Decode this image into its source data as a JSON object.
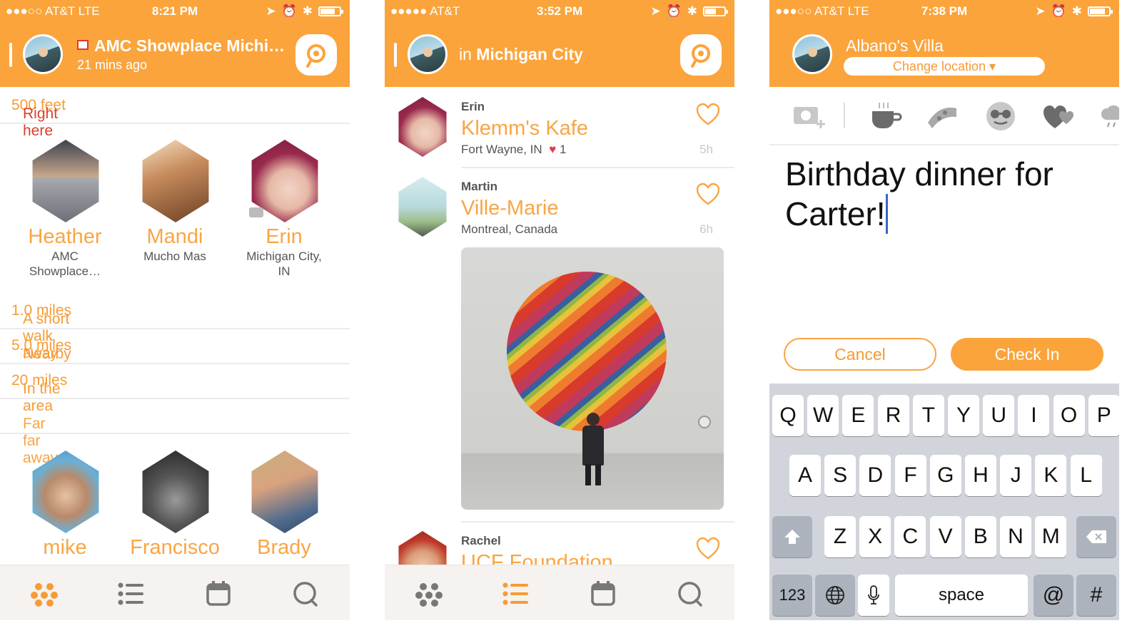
{
  "screen1": {
    "status": {
      "carrier": "●●●○○ AT&T  LTE",
      "time": "8:21 PM"
    },
    "header": {
      "title": "AMC Showplace Michi…",
      "subtitle": "21 mins ago"
    },
    "sections": [
      {
        "label": "Right here",
        "distance": "500 feet"
      },
      {
        "label": "A short walk away",
        "distance": "1.0 miles"
      },
      {
        "label": "Nearby",
        "distance": "5.0 miles"
      },
      {
        "label": "In the area",
        "distance": "20 miles"
      },
      {
        "label": "Far far away",
        "distance": ""
      }
    ],
    "friends": [
      {
        "name": "Heather",
        "loc1": "AMC",
        "loc2": "Showplace…"
      },
      {
        "name": "Mandi",
        "loc1": "Mucho Mas",
        "loc2": ""
      },
      {
        "name": "Erin",
        "loc1": "Michigan City,",
        "loc2": "IN"
      },
      {
        "name": "mike",
        "loc1": "",
        "loc2": ""
      },
      {
        "name": "Francisco",
        "loc1": "",
        "loc2": ""
      },
      {
        "name": "Brady",
        "loc1": "",
        "loc2": ""
      }
    ]
  },
  "screen2": {
    "status": {
      "carrier": "●●●●● AT&T",
      "time": "3:52 PM"
    },
    "header": {
      "prefix": "in",
      "city": "Michigan City"
    },
    "feed": [
      {
        "user": "Erin",
        "venue": "Klemm's Kafe",
        "location": "Fort Wayne, IN",
        "likes": "1",
        "time": "5h"
      },
      {
        "user": "Martin",
        "venue": "Ville-Marie",
        "location": "Montreal, Canada",
        "likes": "",
        "time": "6h"
      },
      {
        "user": "Rachel",
        "venue": "UCF Foundation",
        "location": "",
        "likes": "",
        "time": ""
      }
    ]
  },
  "screen3": {
    "status": {
      "carrier": "●●●○○ AT&T  LTE",
      "time": "7:38 PM"
    },
    "header": {
      "venue": "Albano's Villa",
      "change_location": "Change location ▾"
    },
    "message": {
      "line1": "Birthday dinner for",
      "line2": "Carter!"
    },
    "buttons": {
      "cancel": "Cancel",
      "checkin": "Check In"
    },
    "keyboard": {
      "row1": [
        "Q",
        "W",
        "E",
        "R",
        "T",
        "Y",
        "U",
        "I",
        "O",
        "P"
      ],
      "row2": [
        "A",
        "S",
        "D",
        "F",
        "G",
        "H",
        "J",
        "K",
        "L"
      ],
      "row3": [
        "Z",
        "X",
        "C",
        "V",
        "B",
        "N",
        "M"
      ],
      "numbers": "123",
      "space": "space",
      "at": "@",
      "hash": "#"
    }
  },
  "colors": {
    "accent": "#FBA43B",
    "text_orange": "#F79B34",
    "heart": "#e53b4c"
  }
}
